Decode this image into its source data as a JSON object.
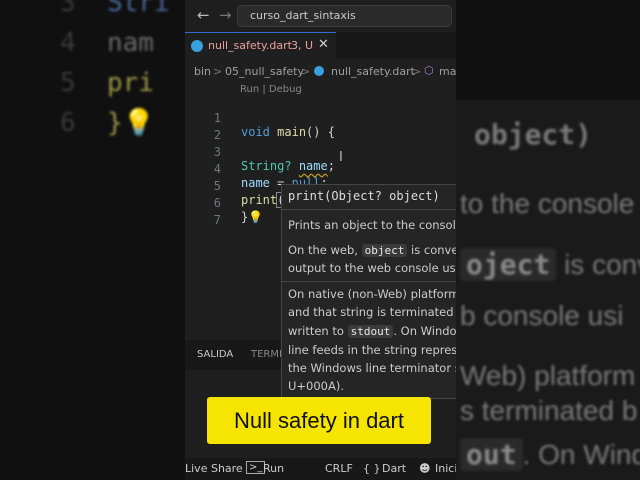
{
  "background": {
    "left_lines": [
      {
        "num": "3",
        "code": "Stri"
      },
      {
        "num": "4",
        "code": "nam"
      },
      {
        "num": "5",
        "code": "pri"
      },
      {
        "num": "6",
        "code": "}💡"
      }
    ],
    "right_fragments": [
      "object)",
      "to the console",
      "oject",
      "is conve",
      "b console usi",
      "Web) platform",
      "s terminated b",
      "out",
      ". On Windo"
    ]
  },
  "titlebar": {
    "back_icon": "arrow-left-icon",
    "forward_icon": "arrow-right-icon",
    "search_text": "curso_dart_sintaxis"
  },
  "tab": {
    "icon": "dart-icon",
    "name": "null_safety.dart",
    "status": "3, U",
    "close": "✕"
  },
  "breadcrumb": {
    "items": [
      "bin",
      ">",
      "05_null_safety",
      ">",
      "null_safety.dart",
      ">",
      "ma"
    ]
  },
  "editor": {
    "codelens": "Run | Debug",
    "line_numbers": [
      "1",
      "2",
      "3",
      "4",
      "5",
      "6",
      "7"
    ],
    "lines": {
      "l1_kw": "void",
      "l1_fn": "main",
      "l1_rest": "() {",
      "l3_type": "String?",
      "l3_var": "name",
      "l3_end": ";",
      "l4_var": "name",
      "l4_eq": " = ",
      "l4_null": "null",
      "l4_end": ";",
      "l5_fn": "print",
      "l5_rest": "()",
      "l6": "}"
    }
  },
  "hover": {
    "signature": "print(Object? object)",
    "p1": "Prints an object to the console",
    "p2a": "On the web,",
    "p2_code": "object",
    "p2b": "is conve",
    "p2c": "output to the web console usi",
    "p3a": "On native (non-Web) platform",
    "p3b": "and that string is terminated b",
    "p3c": "written to",
    "p3_code": "stdout",
    "p3d": ". On Windo",
    "p3e": "line feeds in the string represe",
    "p3f": "the Windows line terminator s",
    "p3g": "U+000A)."
  },
  "panel_tabs": {
    "salida": "SALIDA",
    "terminal": "TERMI"
  },
  "statusbar": {
    "live_share": "Live Share",
    "run": "Run",
    "crlf": "CRLF",
    "lang_icon": "{ }",
    "lang": "Dart",
    "copilot": "Inici"
  },
  "caption": "Null safety in dart",
  "colors": {
    "caption_bg": "#f5e500",
    "keyword": "#569cd6",
    "function": "#dcdcaa",
    "type": "#4ec9b0",
    "variable": "#9cdcfe"
  }
}
